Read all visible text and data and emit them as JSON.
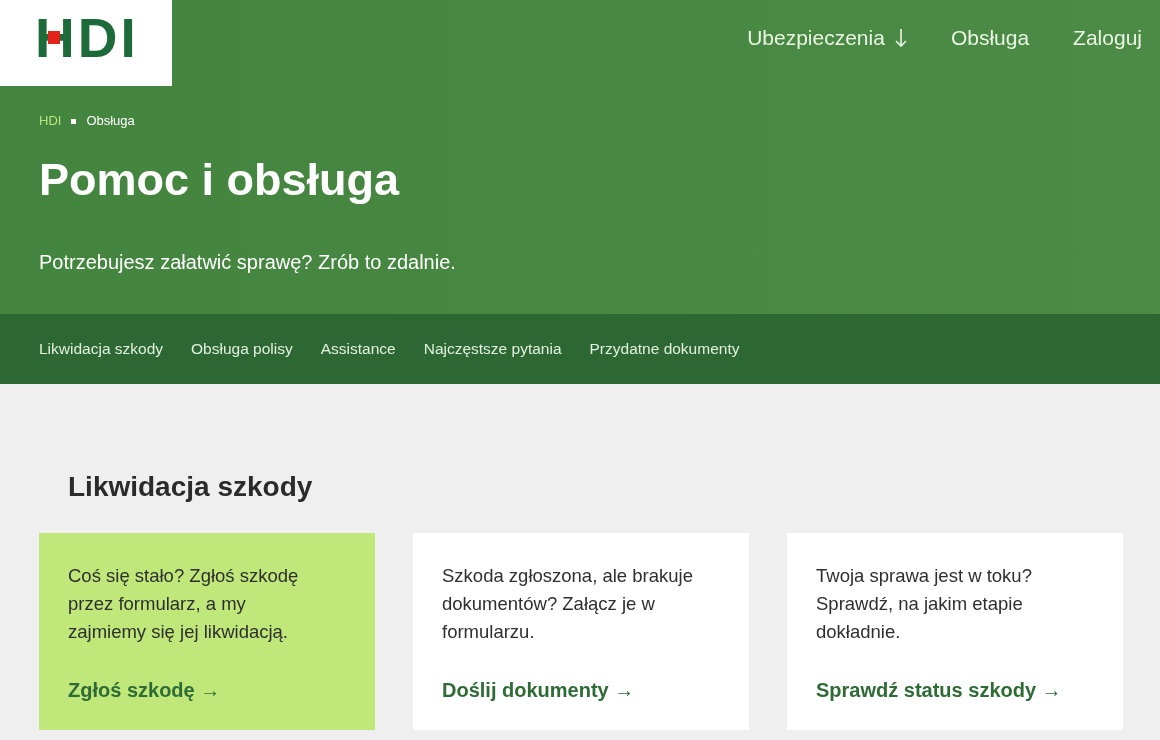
{
  "logo": "HDI",
  "nav": [
    {
      "label": "Ubezpieczenia",
      "has_menu": true
    },
    {
      "label": "Obsługa",
      "has_menu": false
    },
    {
      "label": "Zaloguj",
      "has_menu": false
    }
  ],
  "breadcrumb": [
    {
      "label": "HDI",
      "kind": "link"
    },
    {
      "label": "Obsługa",
      "kind": "current"
    }
  ],
  "hero": {
    "title": "Pomoc i obsługa",
    "subtitle": "Potrzebujesz załatwić sprawę? Zrób to zdalnie."
  },
  "subnav": [
    "Likwidacja szkody",
    "Obsługa polisy",
    "Assistance",
    "Najczęstsze pytania",
    "Przydatne dokumenty"
  ],
  "section": {
    "heading": "Likwidacja szkody",
    "cards": [
      {
        "text": "Coś się stało? Zgłoś szkodę przez formularz, a my zajmiemy się jej likwidacją.",
        "link": "Zgłoś szkodę →",
        "highlighted": true
      },
      {
        "text": "Szkoda zgłoszona, ale brakuje dokumentów? Załącz je w formularzu.",
        "link": "Doślij dokumenty →",
        "highlighted": false
      },
      {
        "text": "Twoja sprawa jest w toku? Sprawdź, na jakim etapie dokładnie.",
        "link": "Sprawdź status szkody →",
        "highlighted": false
      }
    ]
  }
}
